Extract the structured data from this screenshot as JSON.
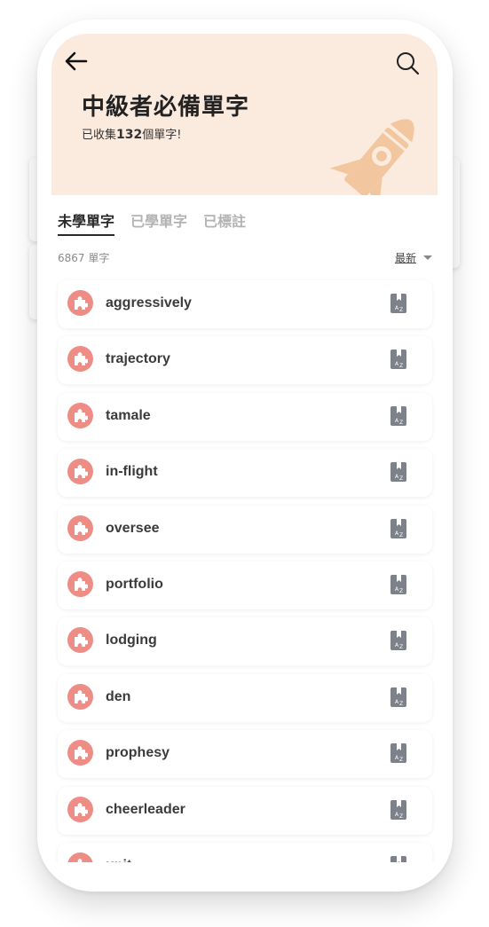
{
  "header": {
    "title": "中級者必備單字",
    "subtitle_prefix": "已收集",
    "subtitle_count": "132",
    "subtitle_suffix": "個單字!"
  },
  "tabs": [
    {
      "label": "未學單字",
      "active": true
    },
    {
      "label": "已學單字",
      "active": false
    },
    {
      "label": "已標註",
      "active": false
    }
  ],
  "list_meta": {
    "count_text": "6867 單字",
    "sort_label": "最新"
  },
  "words": [
    "aggressively",
    "trajectory",
    "tamale",
    "in-flight",
    "oversee",
    "portfolio",
    "lodging",
    "den",
    "prophesy",
    "cheerleader",
    "unit"
  ],
  "colors": {
    "accent_badge": "#ee8c86",
    "hero_bg": "#fbebdf",
    "rocket": "#f2c7a0",
    "mark_icon": "#7d818a"
  },
  "icons": {
    "back": "arrow-left-icon",
    "search": "search-icon",
    "badge": "puzzle-icon",
    "mark": "bookmark-az-icon",
    "decoration": "rocket-icon"
  }
}
